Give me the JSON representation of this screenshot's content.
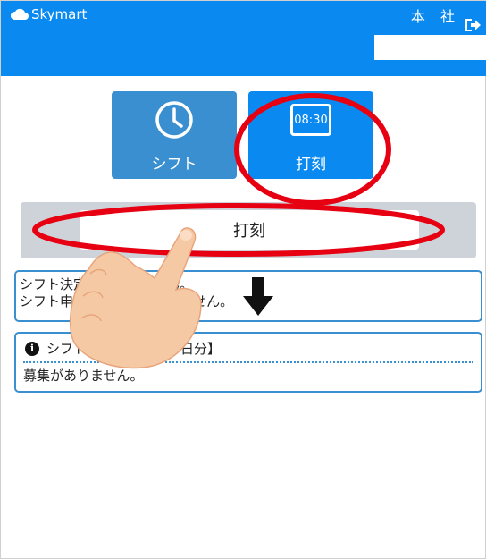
{
  "header": {
    "brand": "Skymart",
    "branch": "本 社"
  },
  "tiles": {
    "shift_label": "シフト",
    "punch_label": "打刻",
    "punch_time": "08:30"
  },
  "punch": {
    "button_label": "打刻"
  },
  "notice": {
    "line1": "シフト決定されていません。",
    "line2": "シフト申請が提出されていません。"
  },
  "recruit": {
    "title": "シフト募集日【直近５日分】",
    "message": "募集がありません。"
  },
  "colors": {
    "header": "#0a8af0",
    "tile_shift": "#3a8fd0",
    "tile_punch": "#0a8af0",
    "highlight_red": "#e60012"
  }
}
